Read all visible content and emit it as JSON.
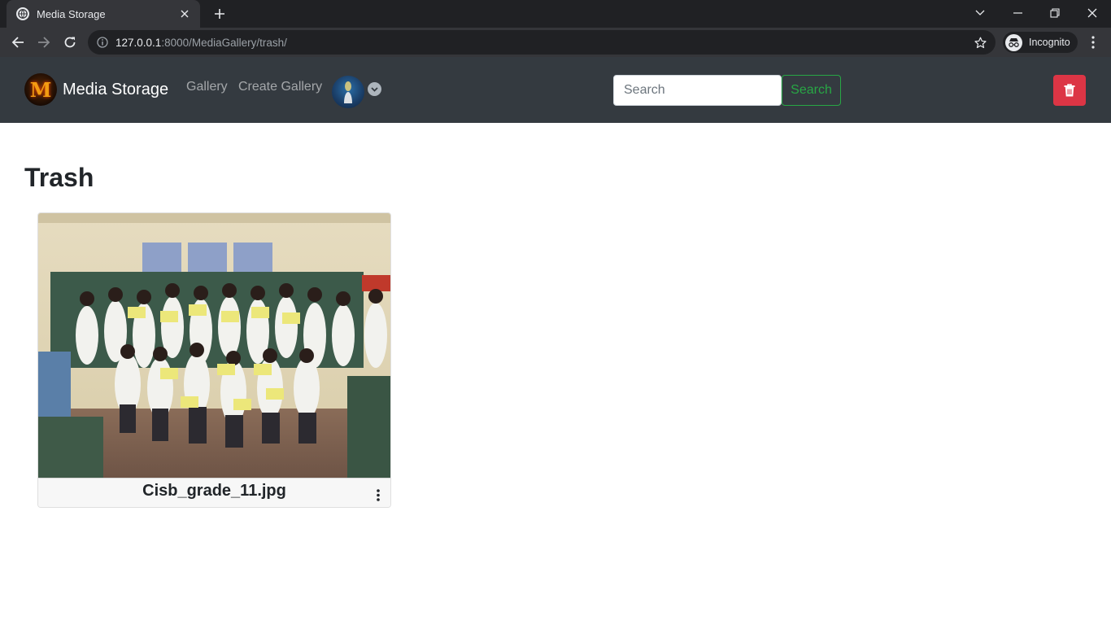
{
  "browser": {
    "tab_title": "Media Storage",
    "url_host": "127.0.0.1",
    "url_rest": ":8000/MediaGallery/trash/",
    "profile_label": "Incognito"
  },
  "navbar": {
    "brand_name": "Media Storage",
    "brand_logo_letter": "M",
    "links": [
      "Gallery",
      "Create Gallery"
    ],
    "search_placeholder": "Search",
    "search_button_label": "Search"
  },
  "page": {
    "title": "Trash",
    "items": [
      {
        "file_name": "Cisb_grade_11.jpg"
      }
    ]
  },
  "colors": {
    "navbar_bg": "#343a40",
    "success": "#28a745",
    "danger": "#dc3545"
  },
  "icons": [
    "globe-icon",
    "close-icon",
    "plus-icon",
    "chevron-down-icon",
    "minimize-icon",
    "restore-icon",
    "back-arrow-icon",
    "forward-arrow-icon",
    "reload-icon",
    "info-icon",
    "star-icon",
    "incognito-icon",
    "kebab-menu-icon",
    "trash-icon",
    "vertical-dots-icon"
  ]
}
